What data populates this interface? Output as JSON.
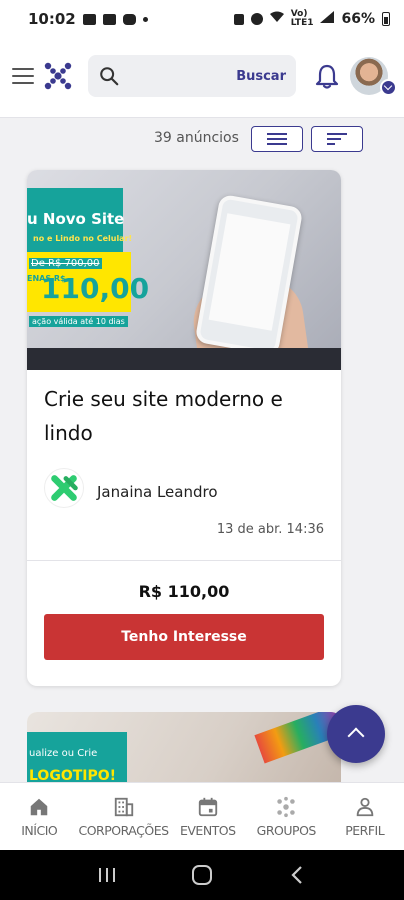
{
  "status_bar": {
    "time": "10:02",
    "battery": "66%",
    "net_top": "Vo)",
    "net_bottom": "LTE1"
  },
  "header": {
    "logo_icon": "x-logo-icon",
    "search_placeholder": "",
    "search_button": "Buscar",
    "accent_color": "#3b3a8f"
  },
  "listing": {
    "count_label": "39 anúncios"
  },
  "card": {
    "image_texts": {
      "headline": "u Novo Site",
      "subline": "no e Lindo no Celular!",
      "old_price": "De R$ 700,00",
      "side_label": "ENAS R$",
      "price": "110,00",
      "validity": "ação válida até 10 dias"
    },
    "title": "Crie seu site moderno e lindo",
    "author": "Janaina Leandro",
    "date": "13 de abr. 14:36",
    "price": "R$ 110,00",
    "cta": "Tenho Interesse",
    "cta_color": "#c93434"
  },
  "card2": {
    "image_text": "ualize ou Crie",
    "image_text2": "LOGOTIPO!"
  },
  "bottom_nav": [
    {
      "label": "INÍCIO",
      "icon": "home-icon"
    },
    {
      "label": "CORPORAÇÕES",
      "icon": "building-icon"
    },
    {
      "label": "EVENTOS",
      "icon": "calendar-icon"
    },
    {
      "label": "GROUPOS",
      "icon": "group-icon"
    },
    {
      "label": "PERFIL",
      "icon": "person-icon"
    }
  ]
}
